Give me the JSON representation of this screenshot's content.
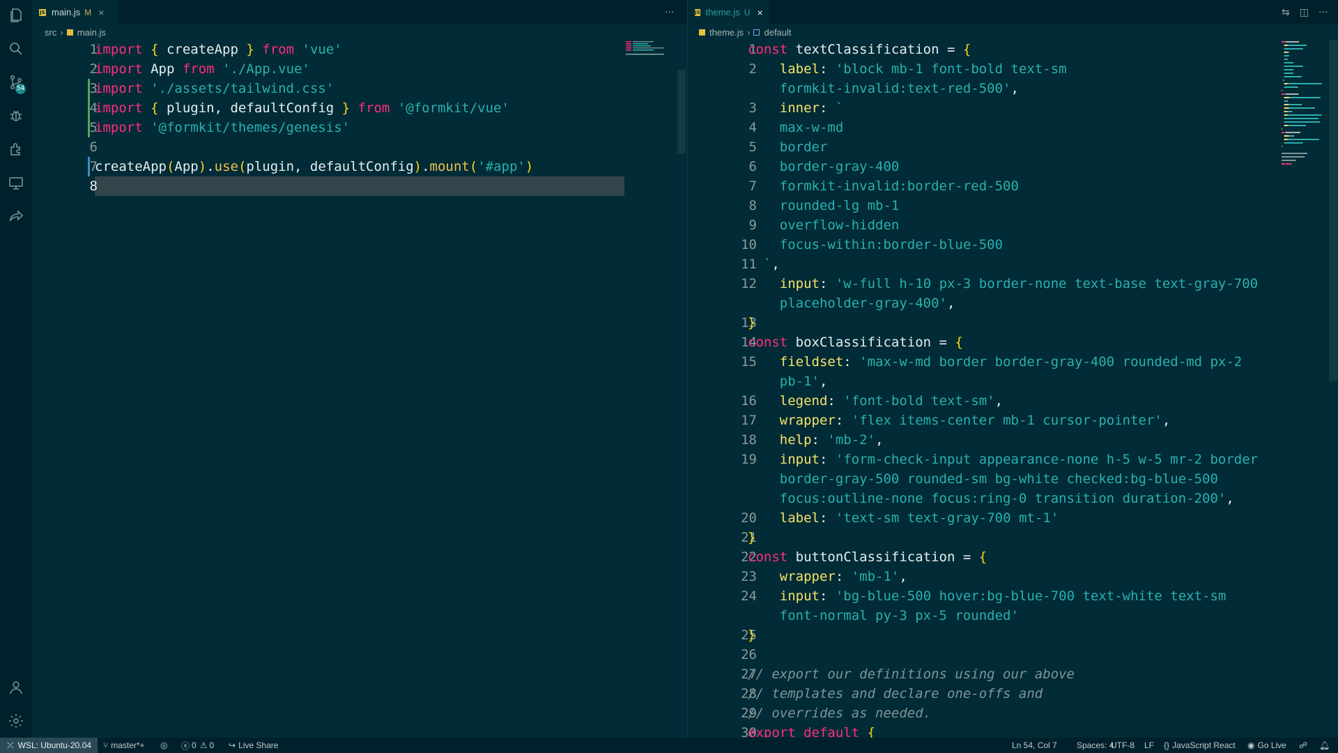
{
  "left_editor": {
    "tab": {
      "name": "main.js",
      "status": "M"
    },
    "breadcrumb": {
      "folder": "src",
      "file": "main.js"
    },
    "more_label": "···",
    "lines": [
      {
        "n": "1",
        "parts": [
          [
            "kw",
            "import"
          ],
          [
            "pl",
            " "
          ],
          [
            "br",
            "{"
          ],
          [
            "pl",
            " createApp "
          ],
          [
            "br",
            "}"
          ],
          [
            "pl",
            " "
          ],
          [
            "kw",
            "from"
          ],
          [
            "pl",
            " "
          ],
          [
            "str",
            "'vue'"
          ]
        ]
      },
      {
        "n": "2",
        "parts": [
          [
            "kw",
            "import"
          ],
          [
            "pl",
            " App "
          ],
          [
            "kw",
            "from"
          ],
          [
            "pl",
            " "
          ],
          [
            "str",
            "'./App.vue'"
          ]
        ]
      },
      {
        "n": "3",
        "parts": [
          [
            "kw",
            "import"
          ],
          [
            "pl",
            " "
          ],
          [
            "str",
            "'./assets/tailwind.css'"
          ]
        ]
      },
      {
        "n": "4",
        "parts": [
          [
            "kw",
            "import"
          ],
          [
            "pl",
            " "
          ],
          [
            "br",
            "{"
          ],
          [
            "pl",
            " plugin, defaultConfig "
          ],
          [
            "br",
            "}"
          ],
          [
            "pl",
            " "
          ],
          [
            "kw",
            "from"
          ],
          [
            "pl",
            " "
          ],
          [
            "str",
            "'@formkit/vue'"
          ]
        ]
      },
      {
        "n": "5",
        "parts": [
          [
            "kw",
            "import"
          ],
          [
            "pl",
            " "
          ],
          [
            "str",
            "'@formkit/themes/genesis'"
          ]
        ]
      },
      {
        "n": "6",
        "parts": []
      },
      {
        "n": "7",
        "parts": [
          [
            "pl",
            "createApp"
          ],
          [
            "br",
            "("
          ],
          [
            "pl",
            "App"
          ],
          [
            "br",
            ")"
          ],
          [
            "pl",
            "."
          ],
          [
            "fn",
            "use"
          ],
          [
            "br",
            "("
          ],
          [
            "pl",
            "plugin, defaultConfig"
          ],
          [
            "br",
            ")"
          ],
          [
            "pl",
            "."
          ],
          [
            "fn",
            "mount"
          ],
          [
            "br",
            "("
          ],
          [
            "str",
            "'#app'"
          ],
          [
            "br",
            ")"
          ]
        ]
      },
      {
        "n": "8",
        "parts": []
      }
    ]
  },
  "right_editor": {
    "tab": {
      "name": "theme.js",
      "status": "U"
    },
    "breadcrumb": {
      "file": "theme.js",
      "symbol": "default"
    },
    "lines": [
      {
        "n": "1",
        "parts": [
          [
            "kw",
            "const"
          ],
          [
            "pl",
            " textClassification = "
          ],
          [
            "br",
            "{"
          ]
        ]
      },
      {
        "n": "2",
        "parts": [
          [
            "pl",
            "    "
          ],
          [
            "prop",
            "label"
          ],
          [
            "pl",
            ": "
          ],
          [
            "str",
            "'block mb-1 font-bold text-sm"
          ]
        ]
      },
      {
        "n": "",
        "parts": [
          [
            "pl",
            "    "
          ],
          [
            "str",
            "formkit-invalid:text-red-500'"
          ],
          [
            "pl",
            ","
          ]
        ]
      },
      {
        "n": "3",
        "parts": [
          [
            "pl",
            "    "
          ],
          [
            "prop",
            "inner"
          ],
          [
            "pl",
            ": "
          ],
          [
            "str",
            "`"
          ]
        ]
      },
      {
        "n": "4",
        "parts": [
          [
            "pl",
            "    "
          ],
          [
            "str",
            "max-w-md"
          ]
        ]
      },
      {
        "n": "5",
        "parts": [
          [
            "pl",
            "    "
          ],
          [
            "str",
            "border"
          ]
        ]
      },
      {
        "n": "6",
        "parts": [
          [
            "pl",
            "    "
          ],
          [
            "str",
            "border-gray-400"
          ]
        ]
      },
      {
        "n": "7",
        "parts": [
          [
            "pl",
            "    "
          ],
          [
            "str",
            "formkit-invalid:border-red-500"
          ]
        ]
      },
      {
        "n": "8",
        "parts": [
          [
            "pl",
            "    "
          ],
          [
            "str",
            "rounded-lg mb-1"
          ]
        ]
      },
      {
        "n": "9",
        "parts": [
          [
            "pl",
            "    "
          ],
          [
            "str",
            "overflow-hidden"
          ]
        ]
      },
      {
        "n": "10",
        "parts": [
          [
            "pl",
            "    "
          ],
          [
            "str",
            "focus-within:border-blue-500"
          ]
        ]
      },
      {
        "n": "11",
        "parts": [
          [
            "pl",
            "  "
          ],
          [
            "str",
            "`"
          ],
          [
            "pl",
            ","
          ]
        ]
      },
      {
        "n": "12",
        "parts": [
          [
            "pl",
            "    "
          ],
          [
            "prop",
            "input"
          ],
          [
            "pl",
            ": "
          ],
          [
            "str",
            "'w-full h-10 px-3 border-none text-base text-gray-700"
          ]
        ]
      },
      {
        "n": "",
        "parts": [
          [
            "pl",
            "    "
          ],
          [
            "str",
            "placeholder-gray-400'"
          ],
          [
            "pl",
            ","
          ]
        ]
      },
      {
        "n": "13",
        "parts": [
          [
            "br",
            "}"
          ]
        ]
      },
      {
        "n": "14",
        "parts": [
          [
            "kw",
            "const"
          ],
          [
            "pl",
            " boxClassification = "
          ],
          [
            "br",
            "{"
          ]
        ]
      },
      {
        "n": "15",
        "parts": [
          [
            "pl",
            "    "
          ],
          [
            "prop",
            "fieldset"
          ],
          [
            "pl",
            ": "
          ],
          [
            "str",
            "'max-w-md border border-gray-400 rounded-md px-2"
          ]
        ]
      },
      {
        "n": "",
        "parts": [
          [
            "pl",
            "    "
          ],
          [
            "str",
            "pb-1'"
          ],
          [
            "pl",
            ","
          ]
        ]
      },
      {
        "n": "16",
        "parts": [
          [
            "pl",
            "    "
          ],
          [
            "prop",
            "legend"
          ],
          [
            "pl",
            ": "
          ],
          [
            "str",
            "'font-bold text-sm'"
          ],
          [
            "pl",
            ","
          ]
        ]
      },
      {
        "n": "17",
        "parts": [
          [
            "pl",
            "    "
          ],
          [
            "prop",
            "wrapper"
          ],
          [
            "pl",
            ": "
          ],
          [
            "str",
            "'flex items-center mb-1 cursor-pointer'"
          ],
          [
            "pl",
            ","
          ]
        ]
      },
      {
        "n": "18",
        "parts": [
          [
            "pl",
            "    "
          ],
          [
            "prop",
            "help"
          ],
          [
            "pl",
            ": "
          ],
          [
            "str",
            "'mb-2'"
          ],
          [
            "pl",
            ","
          ]
        ]
      },
      {
        "n": "19",
        "parts": [
          [
            "pl",
            "    "
          ],
          [
            "prop",
            "input"
          ],
          [
            "pl",
            ": "
          ],
          [
            "str",
            "'form-check-input appearance-none h-5 w-5 mr-2 border"
          ]
        ]
      },
      {
        "n": "",
        "parts": [
          [
            "pl",
            "    "
          ],
          [
            "str",
            "border-gray-500 rounded-sm bg-white checked:bg-blue-500"
          ]
        ]
      },
      {
        "n": "",
        "parts": [
          [
            "pl",
            "    "
          ],
          [
            "str",
            "focus:outline-none focus:ring-0 transition duration-200'"
          ],
          [
            "pl",
            ","
          ]
        ]
      },
      {
        "n": "20",
        "parts": [
          [
            "pl",
            "    "
          ],
          [
            "prop",
            "label"
          ],
          [
            "pl",
            ": "
          ],
          [
            "str",
            "'text-sm text-gray-700 mt-1'"
          ]
        ]
      },
      {
        "n": "21",
        "parts": [
          [
            "br",
            "}"
          ]
        ]
      },
      {
        "n": "22",
        "parts": [
          [
            "kw",
            "const"
          ],
          [
            "pl",
            " buttonClassification = "
          ],
          [
            "br",
            "{"
          ]
        ]
      },
      {
        "n": "23",
        "parts": [
          [
            "pl",
            "    "
          ],
          [
            "prop",
            "wrapper"
          ],
          [
            "pl",
            ": "
          ],
          [
            "str",
            "'mb-1'"
          ],
          [
            "pl",
            ","
          ]
        ]
      },
      {
        "n": "24",
        "parts": [
          [
            "pl",
            "    "
          ],
          [
            "prop",
            "input"
          ],
          [
            "pl",
            ": "
          ],
          [
            "str",
            "'bg-blue-500 hover:bg-blue-700 text-white text-sm"
          ]
        ]
      },
      {
        "n": "",
        "parts": [
          [
            "pl",
            "    "
          ],
          [
            "str",
            "font-normal py-3 px-5 rounded'"
          ]
        ]
      },
      {
        "n": "25",
        "parts": [
          [
            "br",
            "}"
          ]
        ]
      },
      {
        "n": "26",
        "parts": []
      },
      {
        "n": "27",
        "parts": [
          [
            "cmt",
            "// export our definitions using our above"
          ]
        ]
      },
      {
        "n": "28",
        "parts": [
          [
            "cmt",
            "// templates and declare one-offs and"
          ]
        ]
      },
      {
        "n": "29",
        "parts": [
          [
            "cmt",
            "// overrides as needed."
          ]
        ]
      },
      {
        "n": "30",
        "parts": [
          [
            "kw",
            "export"
          ],
          [
            "pl",
            " "
          ],
          [
            "kw",
            "default"
          ],
          [
            "pl",
            " "
          ],
          [
            "br",
            "{"
          ]
        ]
      }
    ]
  },
  "activity_bar": {
    "items": [
      {
        "icon": "files-icon"
      },
      {
        "icon": "search-icon"
      },
      {
        "icon": "source-control-icon",
        "badge": "54"
      },
      {
        "icon": "debug-icon"
      },
      {
        "icon": "extensions-icon"
      },
      {
        "icon": "remote-explorer-icon"
      },
      {
        "icon": "live-share-icon"
      }
    ],
    "bottom": [
      {
        "icon": "account-icon"
      },
      {
        "icon": "settings-gear-icon"
      }
    ]
  },
  "statusbar": {
    "remote": "WSL: Ubuntu-20.04",
    "branch": "master*+",
    "errors": "0",
    "warnings": "0",
    "live_share": "Live Share",
    "position": "Ln 54, Col 7",
    "spaces": "Spaces: 4",
    "encoding": "UTF-8",
    "eol": "LF",
    "language": "JavaScript React",
    "go_live": "Go Live"
  },
  "colors": {
    "background": "#002b36",
    "keyword": "#ff2e7e",
    "string": "#2ab0b0",
    "function": "#f0c24b",
    "comment": "#7f9699"
  }
}
